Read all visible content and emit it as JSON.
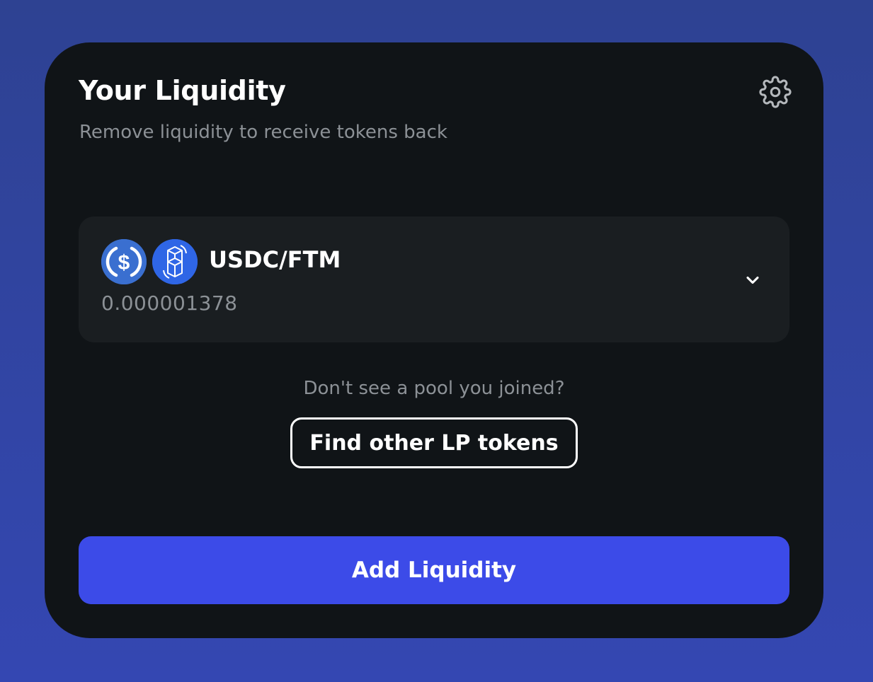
{
  "header": {
    "title": "Your Liquidity",
    "subtitle": "Remove liquidity to receive tokens back",
    "settings_icon": "gear-icon"
  },
  "pools": [
    {
      "pair": "USDC/FTM",
      "balance": "0.000001378",
      "token_icons": [
        "usdc-icon",
        "ftm-icon"
      ],
      "token_colors": [
        "#3a6fd0",
        "#2f66e6"
      ],
      "expand_icon": "chevron-down-icon"
    }
  ],
  "hint": "Don't see a pool you joined?",
  "find_button_label": "Find other LP tokens",
  "add_button_label": "Add Liquidity",
  "colors": {
    "background": "#3040a0",
    "card": "#101417",
    "pool_card": "#1a1e21",
    "accent": "#3c4be8",
    "muted_text": "#8c9196"
  }
}
